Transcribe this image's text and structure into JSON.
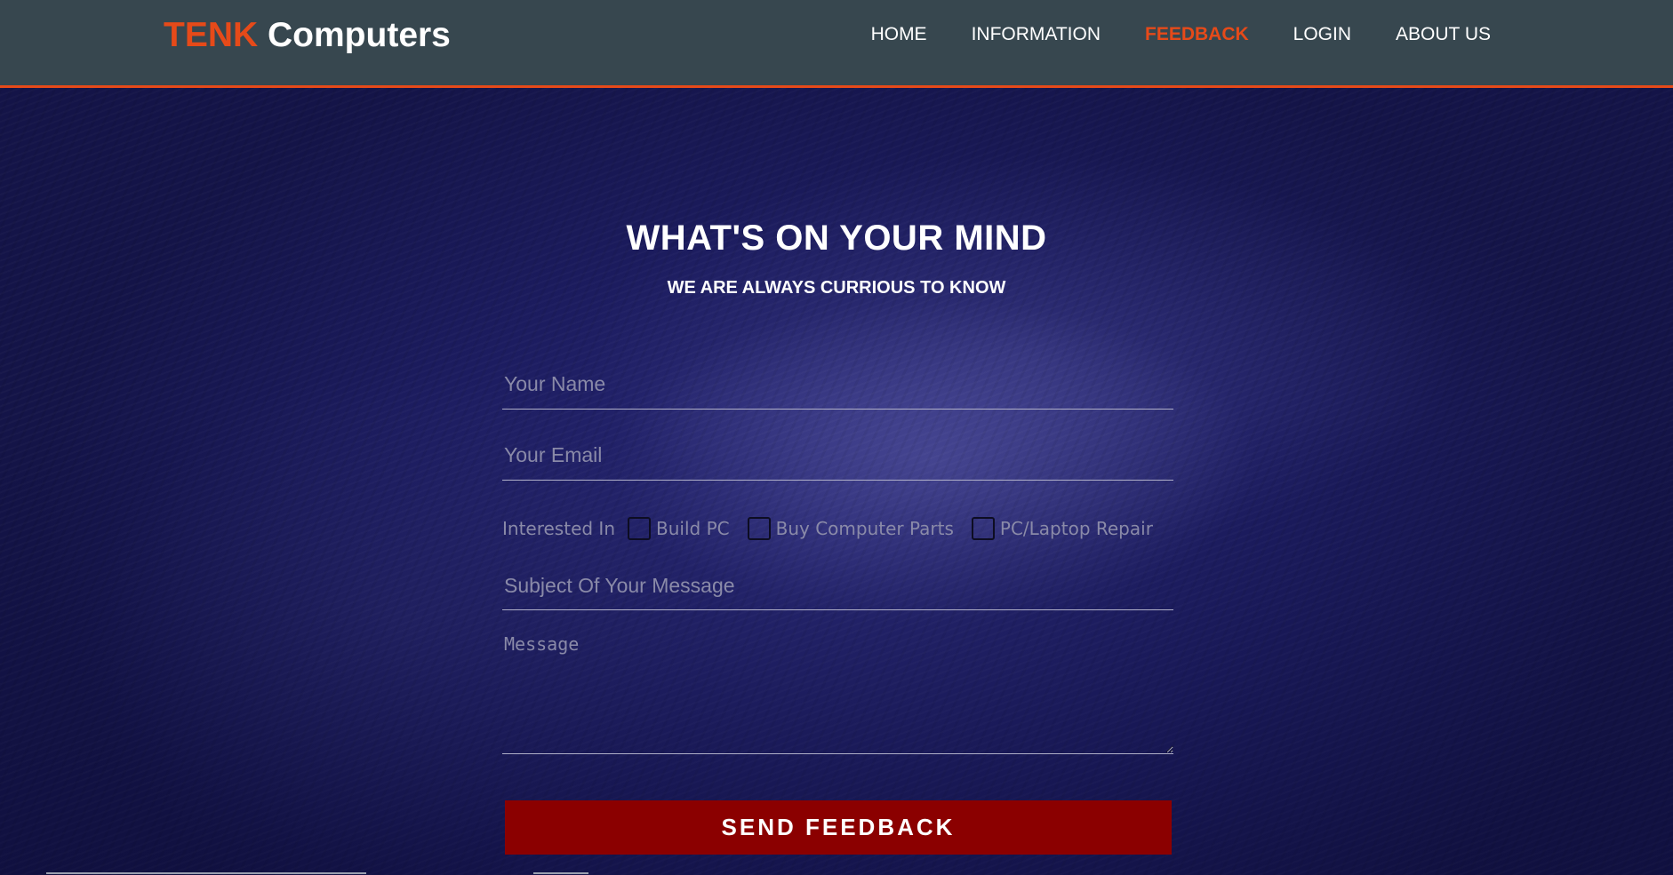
{
  "brand": {
    "accent": "TENK",
    "name": "Computers"
  },
  "nav": [
    {
      "label": "HOME",
      "active": false
    },
    {
      "label": "INFORMATION",
      "active": false
    },
    {
      "label": "FEEDBACK",
      "active": true
    },
    {
      "label": "LOGIN",
      "active": false
    },
    {
      "label": "ABOUT US",
      "active": false
    }
  ],
  "hero": {
    "title": "WHAT'S ON YOUR MIND",
    "subtitle": "WE ARE ALWAYS CURRIOUS TO KNOW"
  },
  "form": {
    "name_placeholder": "Your Name",
    "email_placeholder": "Your Email",
    "interested_label": "Interested In",
    "options": [
      "Build PC",
      "Buy Computer Parts",
      "PC/Laptop Repair"
    ],
    "subject_placeholder": "Subject Of Your Message",
    "message_placeholder": "Message",
    "send_label": "SEND FEEDBACK"
  },
  "colors": {
    "header_bg": "#37474f",
    "accent": "#e64a19",
    "button_bg": "#8b0000",
    "hero_bg": "#1c1c60"
  }
}
